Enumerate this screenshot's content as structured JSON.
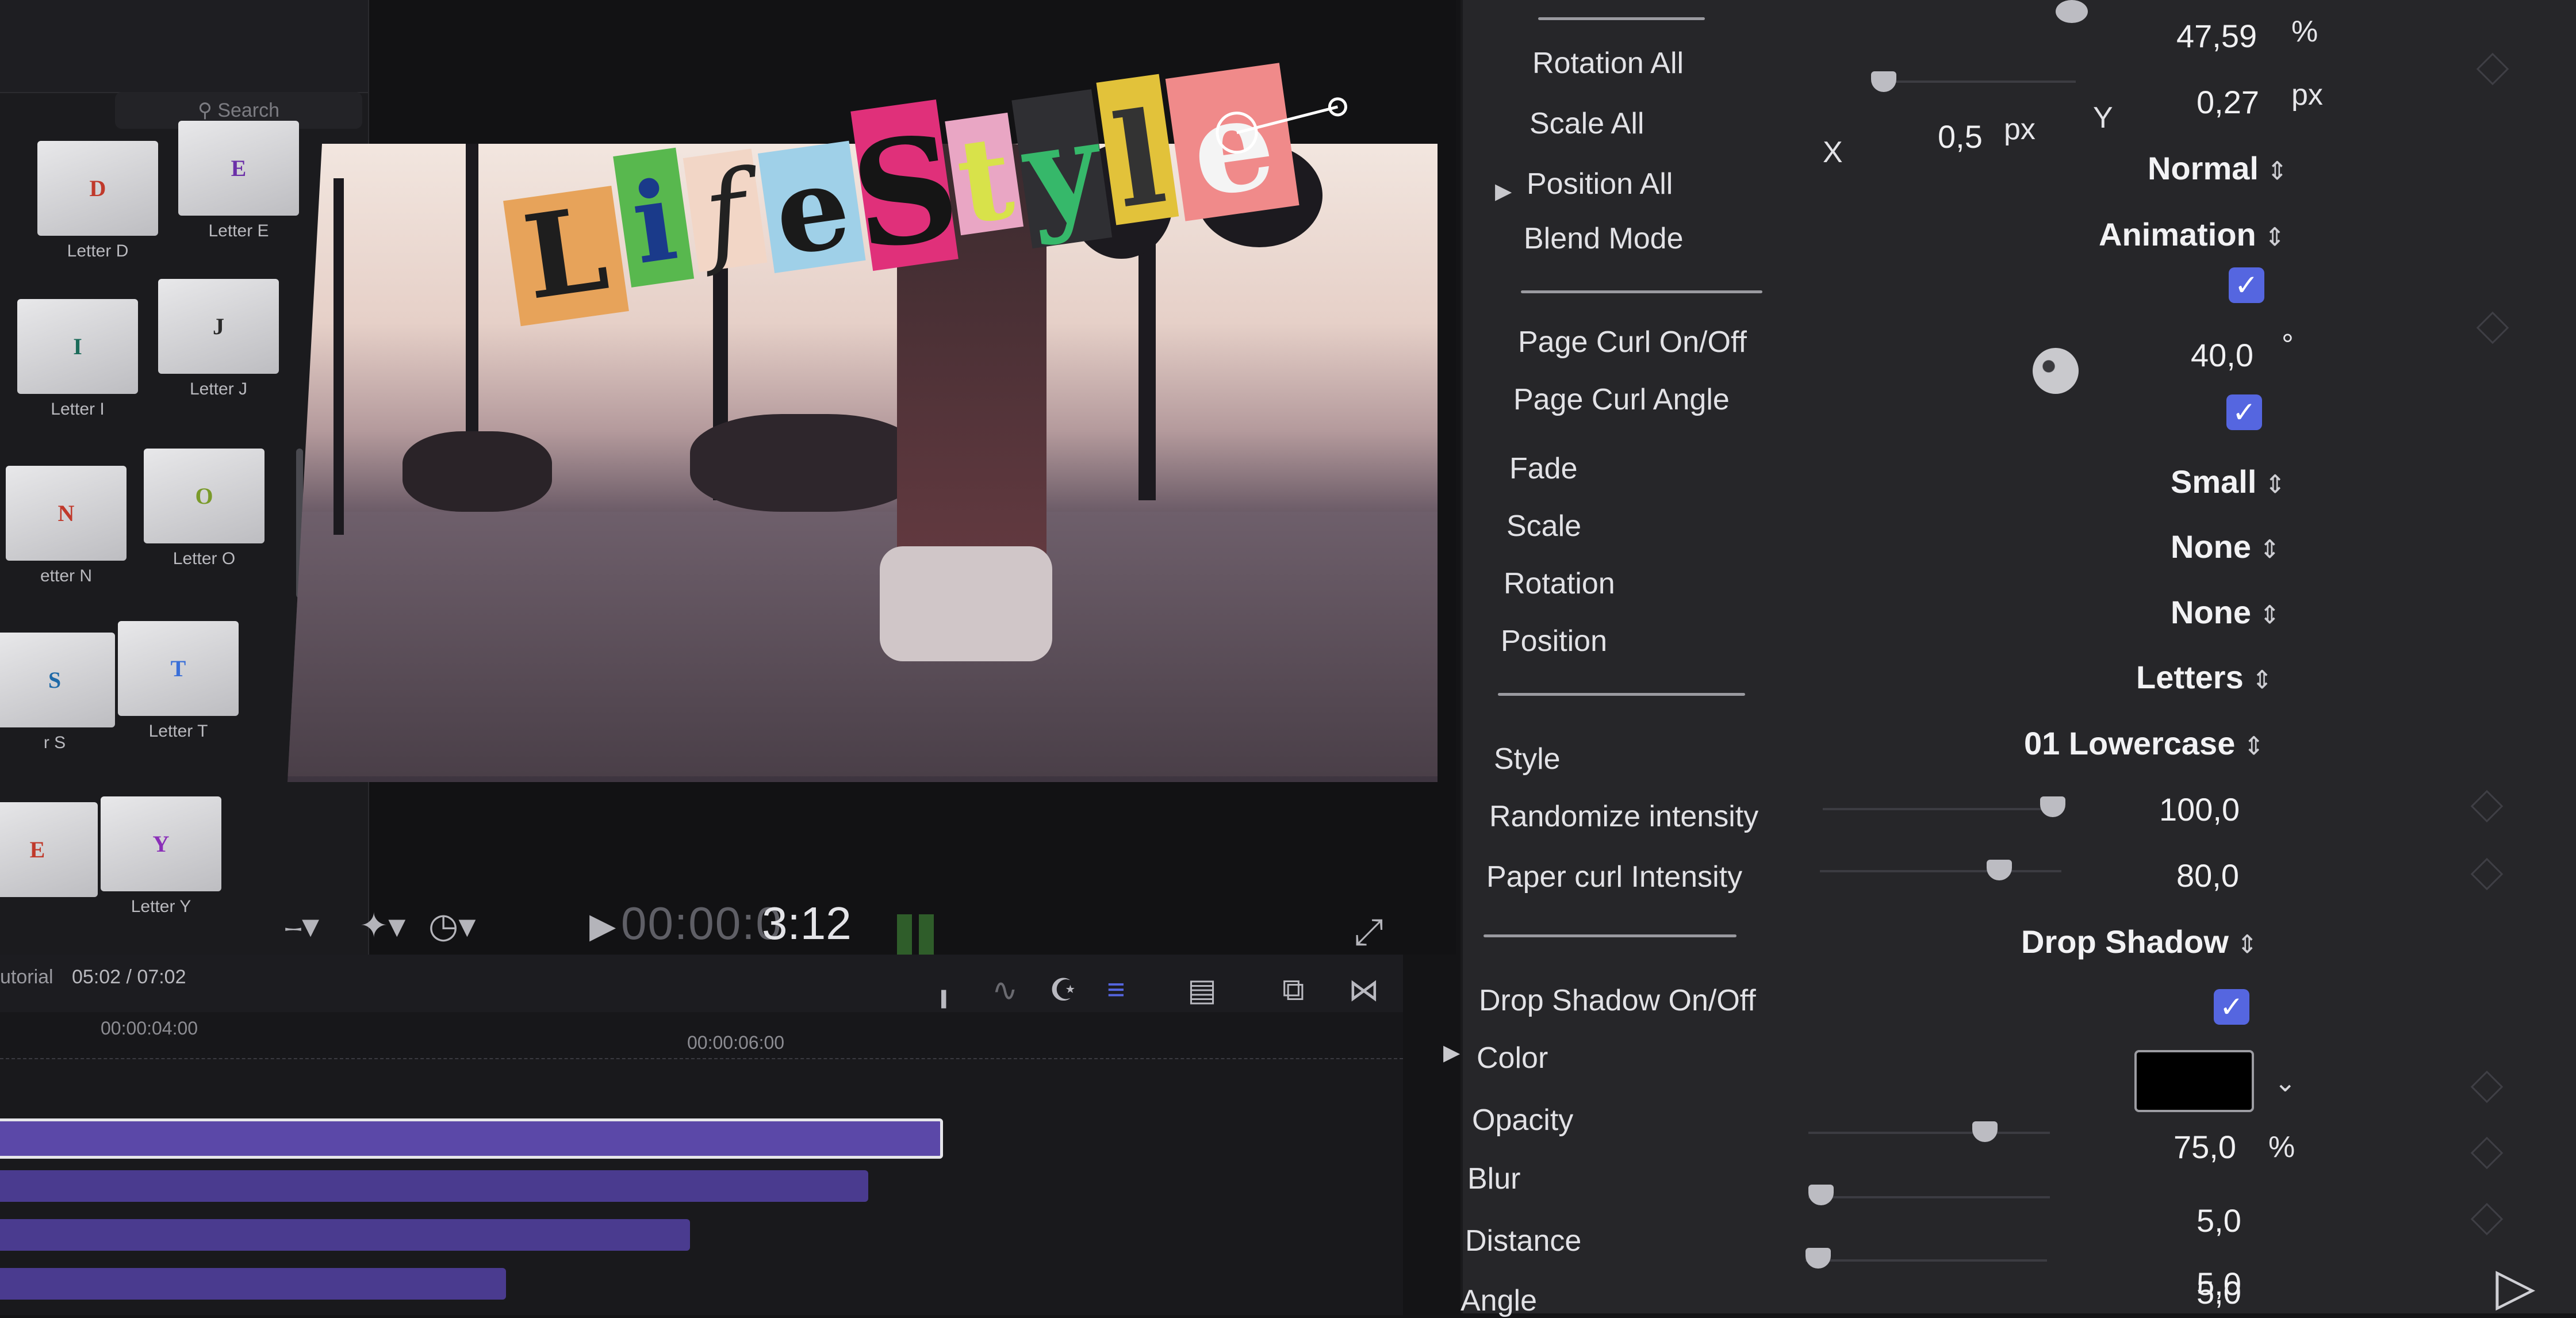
{
  "browser": {
    "search_placeholder": "Search",
    "tiles": [
      {
        "glyph": "D",
        "glyph_color": "#c0392b",
        "label": "Letter D"
      },
      {
        "glyph": "E",
        "glyph_color": "#6b2fa8",
        "label": "Letter E"
      },
      {
        "glyph": "I",
        "glyph_color": "#1c6b5a",
        "label": "Letter I"
      },
      {
        "glyph": "J",
        "glyph_color": "#2a2a2a",
        "label": "Letter J"
      },
      {
        "glyph": "N",
        "glyph_color": "#c0392b",
        "label": "etter N"
      },
      {
        "glyph": "O",
        "glyph_color": "#7a9a2a",
        "label": "Letter O"
      },
      {
        "glyph": "S",
        "glyph_color": "#1f6aa8",
        "label": "r S"
      },
      {
        "glyph": "T",
        "glyph_color": "#3a6fd8",
        "label": "Letter T"
      },
      {
        "glyph": "E",
        "glyph_color": "#c0392b",
        "label": ""
      },
      {
        "glyph": "Y",
        "glyph_color": "#8a2fb8",
        "label": "Letter Y"
      }
    ]
  },
  "viewer": {
    "title_letters": [
      "L",
      "i",
      "f",
      "e",
      "S",
      "t",
      "y",
      "l",
      "e"
    ],
    "timecode_dim": "00:00:0",
    "timecode_bright": "3:12"
  },
  "timeline": {
    "project_name": "utorial",
    "project_duration": "05:02 / 07:02",
    "ruler_labels": [
      "00:00:04:00",
      "00:00:06:00"
    ]
  },
  "inspector": {
    "rotation_all_label": "Rotation All",
    "rotation_all_value": "47,59",
    "rotation_all_unit": "%",
    "scale_all_label": "Scale All",
    "scale_all_x_value": "0,5",
    "scale_all_x_unit": "px",
    "scale_all_y_value": "0,27",
    "scale_all_y_unit": "px",
    "x_label": "X",
    "y_label": "Y",
    "position_all_label": "Position All",
    "blend_mode_label": "Blend Mode",
    "blend_mode_value": "Normal",
    "animation_popup": "Animation",
    "page_curl_onoff_label": "Page Curl On/Off",
    "page_curl_angle_label": "Page Curl Angle",
    "page_curl_angle_value": "40,0",
    "page_curl_angle_unit": "°",
    "fade_label": "Fade",
    "scale_label": "Scale",
    "rotation_label": "Rotation",
    "position_label": "Position",
    "fade_value": "Small",
    "scale_value": "None",
    "rotation_value": "None",
    "position_value": "Letters",
    "style_label": "Style",
    "style_value": "01 Lowercase",
    "randomize_label": "Randomize intensity",
    "randomize_value": "100,0",
    "randomize_level": 1.0,
    "paper_curl_label": "Paper curl Intensity",
    "paper_curl_value": "80,0",
    "paper_curl_level": 0.8,
    "drop_shadow_popup": "Drop Shadow",
    "drop_shadow_onoff_label": "Drop Shadow On/Off",
    "color_label": "Color",
    "color_value": "#000000",
    "opacity_label": "Opacity",
    "opacity_value": "75,0",
    "opacity_unit": "%",
    "opacity_level": 0.75,
    "blur_label": "Blur",
    "blur_value": "5,0",
    "distance_label": "Distance",
    "distance_value": "5,0",
    "angle_label": "Angle",
    "angle_value": "5,0",
    "checkbox_page_curl": true,
    "checkbox_page_curl_angle": true,
    "checkbox_drop_shadow": true,
    "accent_color": "#5566e0"
  }
}
